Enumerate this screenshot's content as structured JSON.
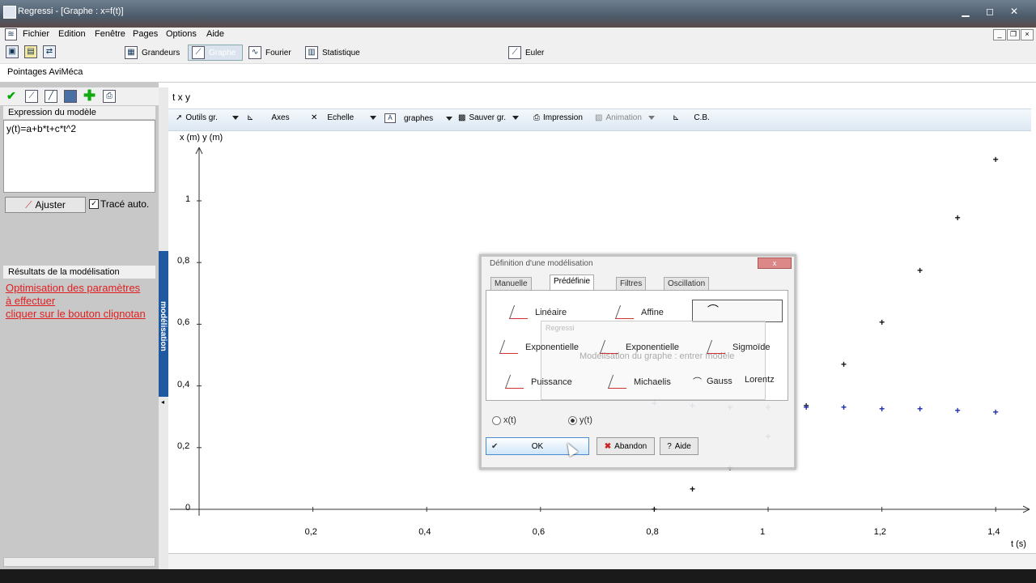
{
  "window": {
    "title": "Regressi - [Graphe : x=f(t)]",
    "min": "▁",
    "max": "◻",
    "close": "✕"
  },
  "menu": [
    "Fichier",
    "Edition",
    "Fenêtre",
    "Pages",
    "Options",
    "Aide"
  ],
  "toolbar": {
    "grandeurs": "Grandeurs",
    "graphe": "Graphe",
    "fourier": "Fourier",
    "statistique": "Statistique",
    "euler": "Euler"
  },
  "pointages": "Pointages AviMéca",
  "left": {
    "expr_header": "Expression du modèle",
    "expression": "y(t)=a+b*t+c*t^2",
    "ajuster": "Ajuster",
    "trace_auto": "Tracé auto.",
    "results_header": "Résultats de la modélisation",
    "results_lines": [
      "Optimisation des paramètres",
      "à effectuer",
      "cliquer sur le bouton clignotan"
    ],
    "side_tab": "modélisation"
  },
  "graph": {
    "vars": "t  x  y",
    "toolbar": {
      "outils": "Outils gr.",
      "axes": "Axes",
      "echelle": "Echelle",
      "graphes": "graphes",
      "sauver": "Sauver gr.",
      "impression": "Impression",
      "animation": "Animation",
      "cb": "C.B."
    }
  },
  "chart_data": {
    "type": "scatter",
    "ylabel": "x (m)  y (m)",
    "xlabel": "t (s)",
    "x_ticks": [
      "0,2",
      "0,4",
      "0,6",
      "0,8",
      "1",
      "1,2",
      "1,4"
    ],
    "y_ticks": [
      "0",
      "0,2",
      "0,4",
      "0,6",
      "0,8",
      "1"
    ],
    "xlim": [
      0,
      1.43
    ],
    "ylim": [
      0,
      1.18
    ],
    "series": [
      {
        "color": "#111111",
        "x": [
          0.8,
          0.867,
          0.933,
          1.0,
          1.067,
          1.133,
          1.2,
          1.267,
          1.333,
          1.4
        ],
        "y": [
          0.0,
          0.065,
          0.135,
          0.235,
          0.335,
          0.47,
          0.605,
          0.775,
          0.945,
          1.135
        ]
      },
      {
        "color": "#1a2aa8",
        "x": [
          0.8,
          0.867,
          0.933,
          1.0,
          1.067,
          1.133,
          1.2,
          1.267,
          1.333,
          1.4
        ],
        "y": [
          0.345,
          0.335,
          0.33,
          0.33,
          0.33,
          0.33,
          0.325,
          0.325,
          0.32,
          0.315
        ]
      }
    ]
  },
  "dialog": {
    "title": "Définition d'une modélisation",
    "tabs": [
      "Manuelle",
      "Prédéfinie",
      "Filtres",
      "Oscillation"
    ],
    "models": [
      "Linéaire",
      "Affine",
      "Exponentielle",
      "Exponentielle",
      "Sigmoïde",
      "Puissance",
      "Michaelis",
      "Gauss",
      "Lorentz"
    ],
    "ghost_title": "Regressi",
    "ghost_text": "Modélisation du graphe : entrer modèle",
    "radio_xt": "x(t)",
    "radio_yt": "y(t)",
    "ok": "OK",
    "abandon": "Abandon",
    "aide": "Aide"
  }
}
